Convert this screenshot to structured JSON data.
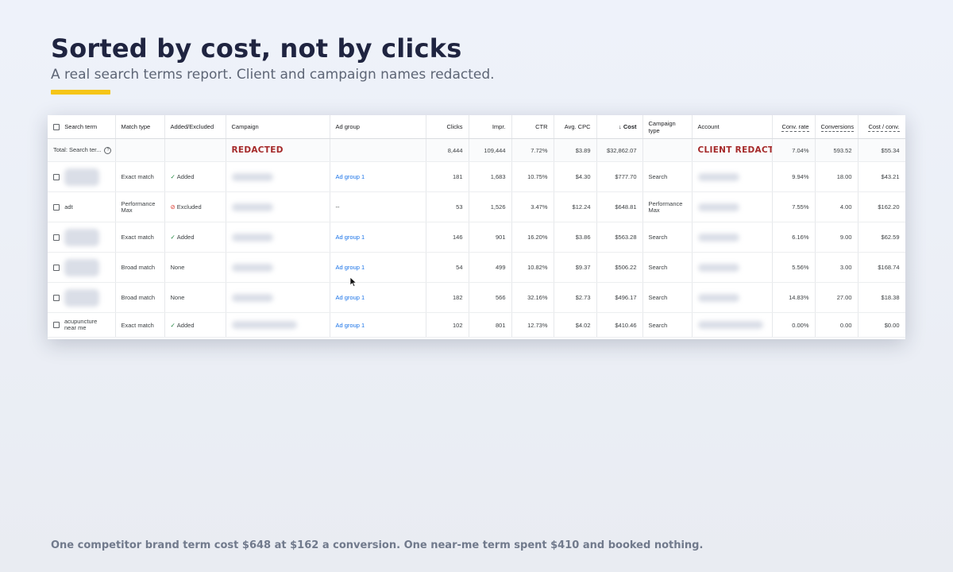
{
  "header": {
    "title": "Sorted by cost, not by clicks",
    "subtitle": "A real search terms report. Client and campaign names redacted."
  },
  "table": {
    "columns": [
      "Search term",
      "Match type",
      "Added/Excluded",
      "Campaign",
      "Ad group",
      "Clicks",
      "Impr.",
      "CTR",
      "Avg. CPC",
      "↓ Cost",
      "Campaign type",
      "Account",
      "Conv. rate",
      "Conversions",
      "Cost / conv."
    ],
    "total": {
      "label": "Total: Search ter...",
      "campaign": "REDACTED",
      "clicks": "8,444",
      "impr": "109,444",
      "ctr": "7.72%",
      "avg_cpc": "$3.89",
      "cost": "$32,862.07",
      "account": "CLIENT REDACTED",
      "conv_rate": "7.04%",
      "conversions": "593.52",
      "cost_conv": "$55.34"
    },
    "rows": [
      {
        "term": "",
        "match": "Exact match",
        "status": "Added",
        "ad_group": "Ad group 1",
        "clicks": "181",
        "impr": "1,683",
        "ctr": "10.75%",
        "cpc": "$4.30",
        "cost": "$777.70",
        "type": "Search",
        "conv_rate": "9.94%",
        "conversions": "18.00",
        "cost_conv": "$43.21"
      },
      {
        "term": "adt",
        "match": "Performance Max",
        "status": "Excluded",
        "ad_group": "--",
        "clicks": "53",
        "impr": "1,526",
        "ctr": "3.47%",
        "cpc": "$12.24",
        "cost": "$648.81",
        "type": "Performance Max",
        "conv_rate": "7.55%",
        "conversions": "4.00",
        "cost_conv": "$162.20"
      },
      {
        "term": "",
        "match": "Exact match",
        "status": "Added",
        "ad_group": "Ad group 1",
        "clicks": "146",
        "impr": "901",
        "ctr": "16.20%",
        "cpc": "$3.86",
        "cost": "$563.28",
        "type": "Search",
        "conv_rate": "6.16%",
        "conversions": "9.00",
        "cost_conv": "$62.59"
      },
      {
        "term": "",
        "match": "Broad match",
        "status": "None",
        "ad_group": "Ad group 1",
        "clicks": "54",
        "impr": "499",
        "ctr": "10.82%",
        "cpc": "$9.37",
        "cost": "$506.22",
        "type": "Search",
        "conv_rate": "5.56%",
        "conversions": "3.00",
        "cost_conv": "$168.74"
      },
      {
        "term": "",
        "match": "Broad match",
        "status": "None",
        "ad_group": "Ad group 1",
        "clicks": "182",
        "impr": "566",
        "ctr": "32.16%",
        "cpc": "$2.73",
        "cost": "$496.17",
        "type": "Search",
        "conv_rate": "14.83%",
        "conversions": "27.00",
        "cost_conv": "$18.38"
      },
      {
        "term": "acupuncture near me",
        "match": "Exact match",
        "status": "Added",
        "ad_group": "Ad group 1",
        "clicks": "102",
        "impr": "801",
        "ctr": "12.73%",
        "cpc": "$4.02",
        "cost": "$410.46",
        "type": "Search",
        "conv_rate": "0.00%",
        "conversions": "0.00",
        "cost_conv": "$0.00"
      }
    ]
  },
  "caption": "One competitor brand term cost $648 at $162 a conversion. One near-me term spent $410 and booked nothing.",
  "icons": {
    "added": "checkmark-icon",
    "excluded": "block-icon",
    "help": "help-circle-icon",
    "cursor": "mouse-pointer-icon"
  },
  "colors": {
    "accent": "#f5c518",
    "redacted": "#a52a2a",
    "link": "#1a73e8"
  }
}
